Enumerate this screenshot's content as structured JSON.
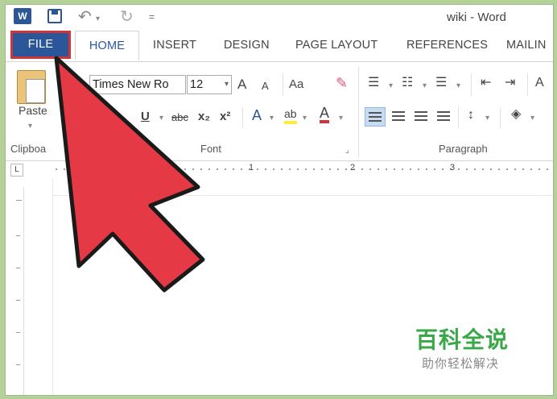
{
  "window": {
    "title": "wiki - Word",
    "app_icon_letter": "W"
  },
  "quick_access": {
    "undo": "↶",
    "redo": "↻",
    "more": "="
  },
  "tabs": [
    {
      "label": "FILE"
    },
    {
      "label": "HOME"
    },
    {
      "label": "INSERT"
    },
    {
      "label": "DESIGN"
    },
    {
      "label": "PAGE LAYOUT"
    },
    {
      "label": "REFERENCES"
    },
    {
      "label": "MAILIN"
    }
  ],
  "clipboard": {
    "paste_label": "Paste",
    "group_label": "Clipboa"
  },
  "font": {
    "name": "Times New Ro",
    "size": "12",
    "grow": "A",
    "shrink": "A",
    "case": "Aa",
    "underline": "U",
    "strikethrough": "abc",
    "subscript": "x₂",
    "superscript": "x²",
    "text_effects": "A",
    "highlight": "ab",
    "font_color": "A",
    "group_label": "Font"
  },
  "paragraph": {
    "group_label": "Paragraph"
  },
  "ruler": {
    "marks": [
      "1",
      "2",
      "3"
    ],
    "corner": "L"
  },
  "watermark": {
    "title": "百科全说",
    "subtitle": "助你轻松解决"
  },
  "colors": {
    "file_tab": "#2b579a",
    "highlight_border": "#d13438",
    "arrow_fill": "#e63946",
    "watermark_green": "#3aa748"
  }
}
